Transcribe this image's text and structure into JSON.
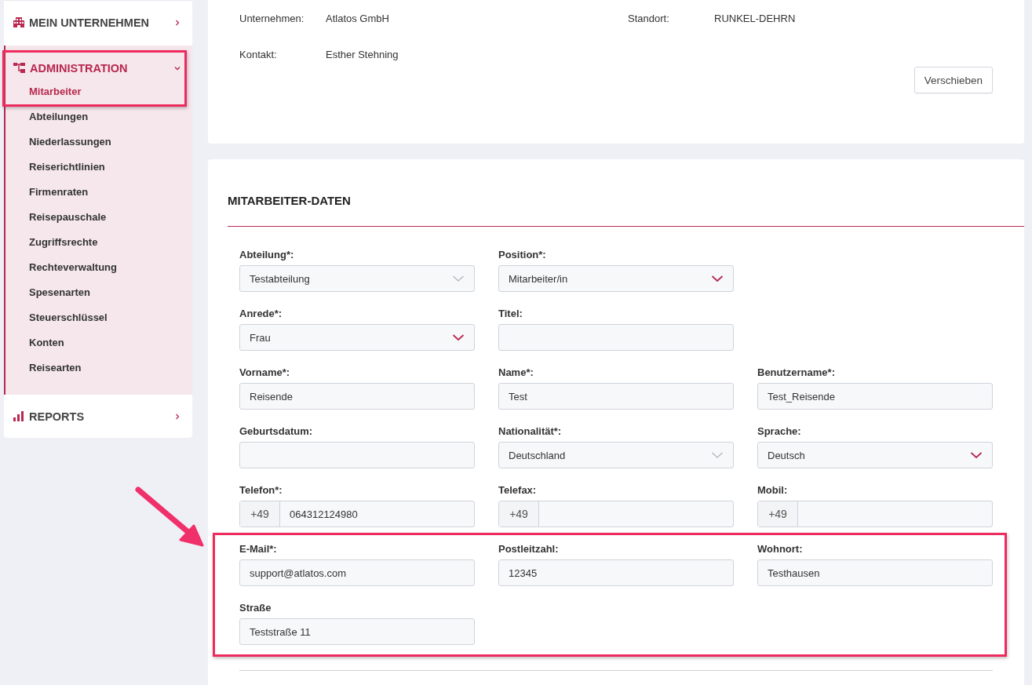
{
  "sidebar": {
    "sections": [
      {
        "label": "MEIN UNTERNEHMEN",
        "selected": false,
        "expanded": false
      },
      {
        "label": "ADMINISTRATION",
        "selected": true,
        "expanded": true,
        "children": [
          {
            "label": "Mitarbeiter",
            "selected": true
          },
          {
            "label": "Abteilungen",
            "selected": false
          },
          {
            "label": "Niederlassungen",
            "selected": false
          },
          {
            "label": "Reiserichtlinien",
            "selected": false
          },
          {
            "label": "Firmenraten",
            "selected": false
          },
          {
            "label": "Reisepauschale",
            "selected": false
          },
          {
            "label": "Zugriffsrechte",
            "selected": false
          },
          {
            "label": "Rechteverwaltung",
            "selected": false
          },
          {
            "label": "Spesenarten",
            "selected": false
          },
          {
            "label": "Steuerschlüssel",
            "selected": false
          },
          {
            "label": "Konten",
            "selected": false
          },
          {
            "label": "Reisearten",
            "selected": false
          }
        ]
      },
      {
        "label": "REPORTS",
        "selected": false,
        "expanded": false
      }
    ]
  },
  "company_card": {
    "info": [
      {
        "label": "Unternehmen:",
        "value": "Atlatos GmbH"
      },
      {
        "label": "Standort:",
        "value": "RUNKEL-DEHRN"
      },
      {
        "label": "Kontakt:",
        "value": "Esther Stehning"
      }
    ],
    "button": "Verschieben"
  },
  "employee_form": {
    "title": "MITARBEITER-DATEN",
    "rows": [
      {
        "fields": [
          {
            "kind": "select",
            "label": "Abteilung*:",
            "value": "Testabteilung",
            "disabled": true
          },
          {
            "kind": "select",
            "label": "Position*:",
            "value": "Mitarbeiter/in",
            "disabled": false
          }
        ]
      },
      {
        "fields": [
          {
            "kind": "select",
            "label": "Anrede*:",
            "value": "Frau",
            "disabled": false
          },
          {
            "kind": "text",
            "label": "Titel:"
          }
        ]
      },
      {
        "fields": [
          {
            "kind": "text",
            "label": "Vorname*:",
            "value": "Reisende"
          },
          {
            "kind": "text",
            "label": "Name*:",
            "value": "Test"
          },
          {
            "kind": "text",
            "label": "Benutzername*:",
            "value": "Test_Reisende"
          }
        ]
      },
      {
        "fields": [
          {
            "kind": "text",
            "label": "Geburtsdatum:"
          },
          {
            "kind": "select",
            "label": "Nationalität*:",
            "value": "Deutschland",
            "disabled": true
          },
          {
            "kind": "select",
            "label": "Sprache:",
            "value": "Deutsch",
            "disabled": false
          }
        ]
      },
      {
        "fields": [
          {
            "kind": "phone",
            "label": "Telefon*:",
            "prefix": "+49",
            "value": "064312124980"
          },
          {
            "kind": "phone",
            "label": "Telefax:",
            "prefix": "+49"
          },
          {
            "kind": "phone",
            "label": "Mobil:",
            "prefix": "+49"
          }
        ]
      },
      {
        "fields": [
          {
            "kind": "text",
            "label": "E-Mail*:",
            "value": "support@atlatos.com"
          },
          {
            "kind": "text",
            "label": "Postleitzahl:",
            "value": "12345"
          },
          {
            "kind": "text",
            "label": "Wohnort:",
            "value": "Testhausen"
          }
        ]
      },
      {
        "fields": [
          {
            "kind": "text",
            "label": "Straße",
            "value": "Teststraße 11"
          }
        ]
      }
    ]
  },
  "annotations": [
    {
      "kind": "box"
    },
    {
      "kind": "box"
    },
    {
      "kind": "arrow"
    }
  ]
}
